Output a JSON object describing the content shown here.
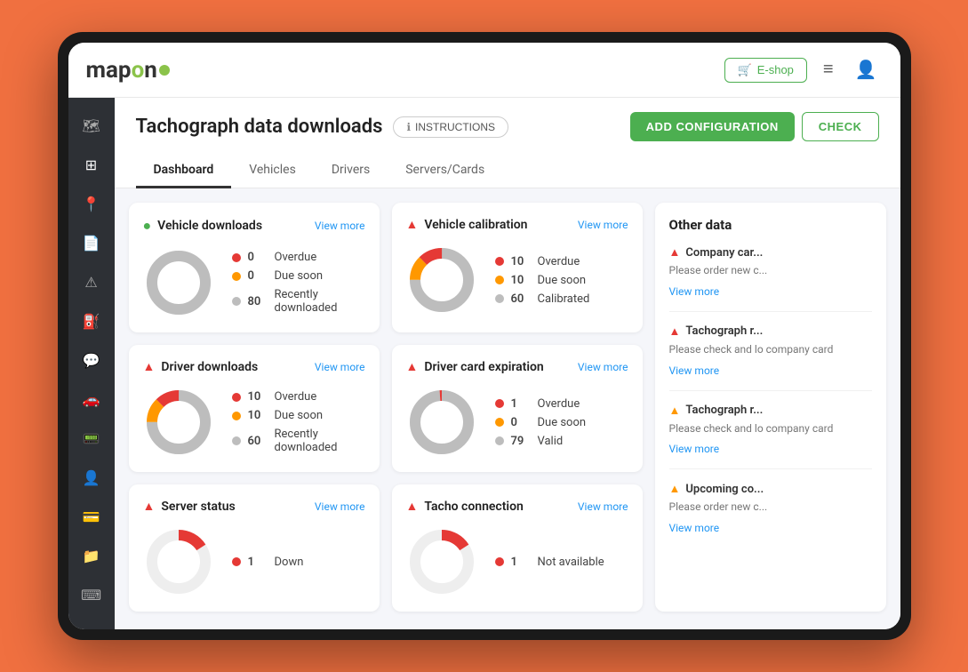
{
  "app": {
    "logo": "mapon",
    "eshop_label": "E-shop",
    "top_icons": [
      "cart",
      "menu",
      "user"
    ]
  },
  "header": {
    "title": "Tachograph data downloads",
    "instructions_label": "INSTRUCTIONS",
    "add_config_label": "ADD CONFIGURATION",
    "check_label": "CHECK"
  },
  "tabs": [
    {
      "label": "Dashboard",
      "active": true
    },
    {
      "label": "Vehicles",
      "active": false
    },
    {
      "label": "Drivers",
      "active": false
    },
    {
      "label": "Servers/Cards",
      "active": false
    }
  ],
  "sidebar": {
    "items": [
      {
        "icon": "map",
        "name": "map-icon"
      },
      {
        "icon": "grid",
        "name": "dashboard-icon"
      },
      {
        "icon": "location",
        "name": "location-icon"
      },
      {
        "icon": "document",
        "name": "document-icon"
      },
      {
        "icon": "alert",
        "name": "alert-icon"
      },
      {
        "icon": "fuel",
        "name": "fuel-icon"
      },
      {
        "icon": "chat",
        "name": "chat-icon"
      },
      {
        "icon": "car",
        "name": "car-icon"
      },
      {
        "icon": "tachograph",
        "name": "tacho-icon"
      },
      {
        "icon": "person",
        "name": "person-icon"
      },
      {
        "icon": "card",
        "name": "card-icon"
      },
      {
        "icon": "folder",
        "name": "folder-icon"
      },
      {
        "icon": "keyboard",
        "name": "keyboard-icon"
      }
    ]
  },
  "cards": {
    "vehicle_downloads": {
      "title": "Vehicle downloads",
      "status": "ok",
      "view_more": "View more",
      "legend": [
        {
          "label": "Overdue",
          "value": 0,
          "color": "#e53935"
        },
        {
          "label": "Due soon",
          "value": 0,
          "color": "#ff9800"
        },
        {
          "label": "Recently downloaded",
          "value": 80,
          "color": "#bdbdbd"
        }
      ],
      "donut": {
        "segments": [
          {
            "value": 0,
            "color": "#e53935"
          },
          {
            "value": 0,
            "color": "#ff9800"
          },
          {
            "value": 80,
            "color": "#bdbdbd"
          }
        ],
        "total": 80
      }
    },
    "vehicle_calibration": {
      "title": "Vehicle calibration",
      "status": "warning",
      "view_more": "View more",
      "legend": [
        {
          "label": "Overdue",
          "value": 10,
          "color": "#e53935"
        },
        {
          "label": "Due soon",
          "value": 10,
          "color": "#ff9800"
        },
        {
          "label": "Calibrated",
          "value": 60,
          "color": "#bdbdbd"
        }
      ],
      "donut": {
        "segments": [
          {
            "value": 10,
            "color": "#e53935"
          },
          {
            "value": 10,
            "color": "#ff9800"
          },
          {
            "value": 60,
            "color": "#bdbdbd"
          }
        ],
        "total": 80
      }
    },
    "driver_downloads": {
      "title": "Driver downloads",
      "status": "warning",
      "view_more": "View more",
      "legend": [
        {
          "label": "Overdue",
          "value": 10,
          "color": "#e53935"
        },
        {
          "label": "Due soon",
          "value": 10,
          "color": "#ff9800"
        },
        {
          "label": "Recently downloaded",
          "value": 60,
          "color": "#bdbdbd"
        }
      ],
      "donut": {
        "segments": [
          {
            "value": 10,
            "color": "#e53935"
          },
          {
            "value": 10,
            "color": "#ff9800"
          },
          {
            "value": 60,
            "color": "#bdbdbd"
          }
        ],
        "total": 80
      }
    },
    "driver_card_expiration": {
      "title": "Driver card expiration",
      "status": "warning",
      "view_more": "View more",
      "legend": [
        {
          "label": "Overdue",
          "value": 1,
          "color": "#e53935"
        },
        {
          "label": "Due soon",
          "value": 0,
          "color": "#ff9800"
        },
        {
          "label": "Valid",
          "value": 79,
          "color": "#bdbdbd"
        }
      ],
      "donut": {
        "segments": [
          {
            "value": 1,
            "color": "#e53935"
          },
          {
            "value": 0,
            "color": "#ff9800"
          },
          {
            "value": 79,
            "color": "#bdbdbd"
          }
        ],
        "total": 80
      }
    },
    "server_status": {
      "title": "Server status",
      "status": "warning",
      "view_more": "View more",
      "legend": [
        {
          "label": "Down",
          "value": 1,
          "color": "#e53935"
        }
      ]
    },
    "tacho_connection": {
      "title": "Tacho connection",
      "status": "warning",
      "view_more": "View more",
      "legend": [
        {
          "label": "Not available",
          "value": 1,
          "color": "#e53935"
        }
      ]
    }
  },
  "other_data": {
    "title": "Other data",
    "alerts": [
      {
        "title": "Company car...",
        "icon": "red",
        "description": "Please order new c...",
        "link": "View more"
      },
      {
        "title": "Tachograph r...",
        "icon": "red",
        "description": "Please check and lo company card",
        "link": "View more"
      },
      {
        "title": "Tachograph r...",
        "icon": "yellow",
        "description": "Please check and lo company card",
        "link": "View more"
      },
      {
        "title": "Upcoming co...",
        "icon": "yellow",
        "description": "Please order new c...",
        "link": "View more"
      }
    ]
  }
}
